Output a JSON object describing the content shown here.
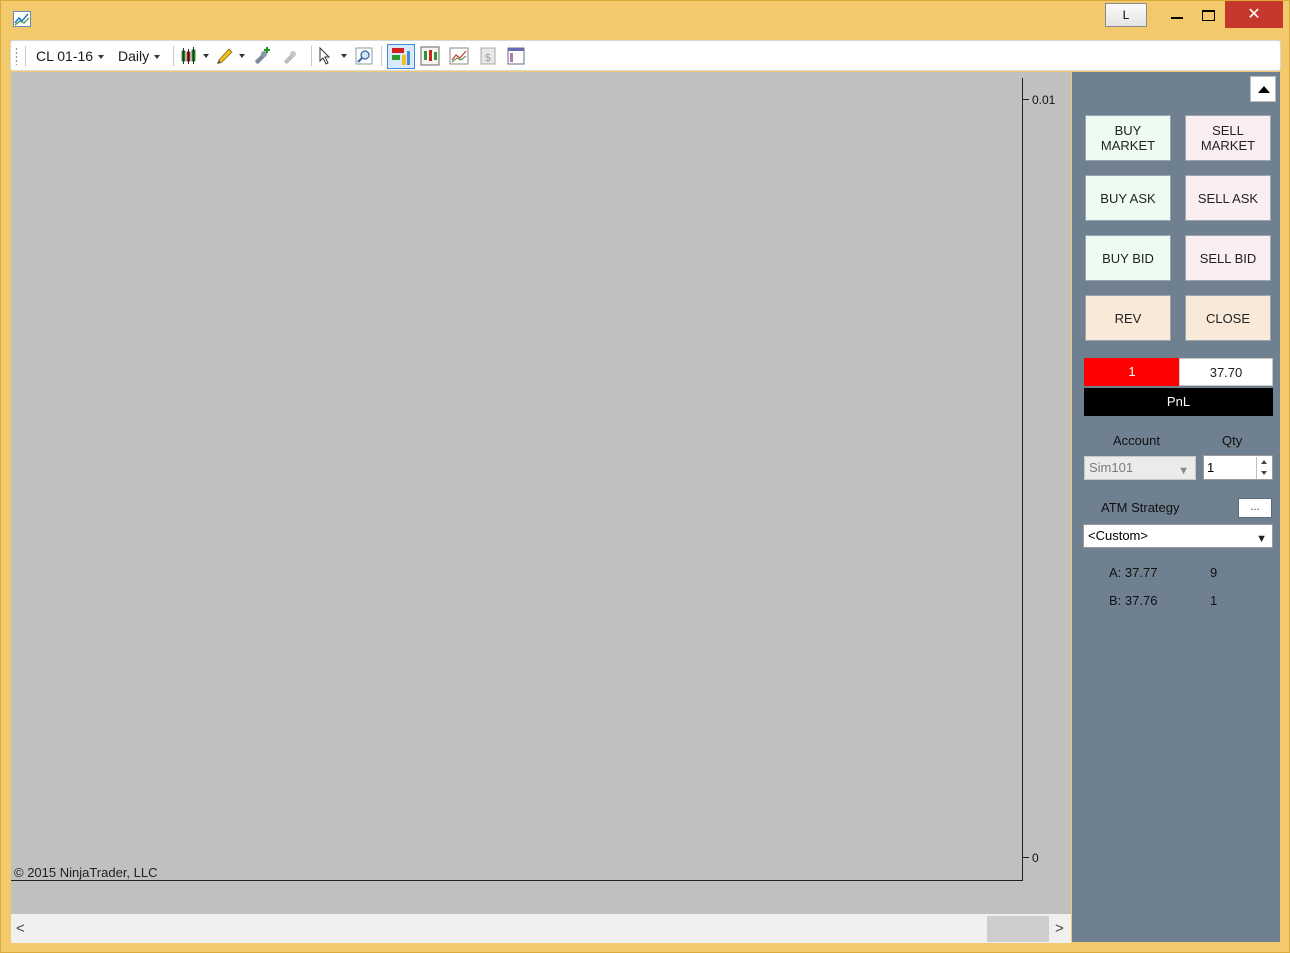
{
  "window": {
    "layout_button_label": "L",
    "close_glyph": "✕"
  },
  "toolbar": {
    "instrument": "CL 01-16",
    "interval": "Daily",
    "icons": [
      "chart-style-icon",
      "drawing-tool-icon",
      "add-indicator-icon",
      "remove-indicator-icon",
      "pointer-icon",
      "zoom-icon",
      "chart-trader-icon",
      "data-series-icon",
      "strategy-icon",
      "performance-icon",
      "properties-icon"
    ]
  },
  "chart": {
    "y_ticks": [
      "0.01",
      "0"
    ],
    "copyright": "© 2015 NinjaTrader, LLC",
    "background": "#c0c0c0"
  },
  "scrollbar": {
    "left_arrow": "<",
    "right_arrow": ">"
  },
  "chart_trader": {
    "buttons": {
      "buy_market": "BUY MARKET",
      "sell_market": "SELL MARKET",
      "buy_ask": "BUY ASK",
      "sell_ask": "SELL ASK",
      "buy_bid": "BUY BID",
      "sell_bid": "SELL BID",
      "rev": "REV",
      "close": "CLOSE"
    },
    "position": {
      "quantity": "1",
      "avg_price": "37.70",
      "pnl_label": "PnL"
    },
    "account_label": "Account",
    "qty_label": "Qty",
    "account_value": "Sim101",
    "qty_value": "1",
    "atm_label": "ATM Strategy",
    "atm_button": "...",
    "atm_value": "<Custom>",
    "quotes": {
      "ask": "A: 37.77",
      "ask_size": "9",
      "bid": "B: 37.76",
      "bid_size": "1"
    },
    "colors": {
      "panel": "#6f8091",
      "position_short": "#ff0000",
      "buy_button": "#eefbf0",
      "sell_button": "#fbeef1"
    }
  }
}
